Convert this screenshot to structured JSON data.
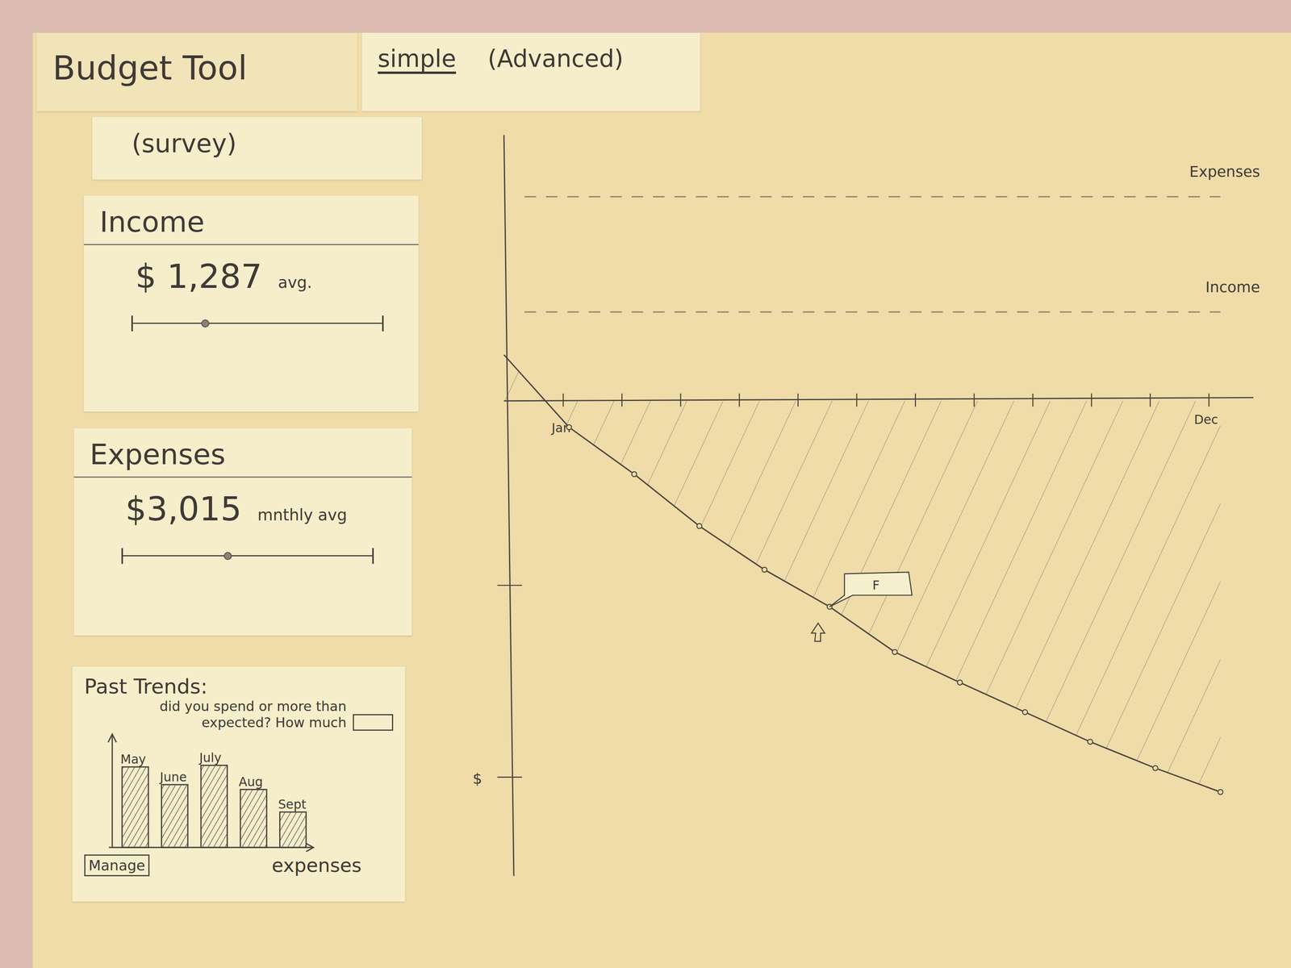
{
  "title": "Budget Tool",
  "tabs": [
    {
      "label": "simple",
      "selected": true
    },
    {
      "label": "(Advanced)",
      "selected": false
    }
  ],
  "survey": "(survey)",
  "income": {
    "title": "Income",
    "amount": "$ 1,287",
    "unit": "avg.",
    "level": 0.29
  },
  "expenses": {
    "title": "Expenses",
    "amount": "$3,015",
    "unit": "mnthly avg",
    "level": 0.42
  },
  "trends": {
    "title": "Past Trends:",
    "question": "did you spend or more than expected? How much",
    "input": "",
    "months": [
      "May",
      "June",
      "July",
      "Aug",
      "Sept"
    ],
    "values": [
      100,
      78,
      102,
      72,
      44
    ],
    "axis_label": "expenses",
    "button": "Manage"
  },
  "chart": {
    "x_labels": [
      "Jan",
      "Dec"
    ],
    "y_label": "$",
    "ticks": 12,
    "y_ticks": [
      -224,
      -457
    ],
    "balance": [
      56,
      -32,
      -89,
      -152,
      -205,
      -250,
      -305,
      -342,
      -378,
      -414,
      -446,
      -475
    ],
    "reference_lines": [
      {
        "label": "Expenses",
        "value": 248
      },
      {
        "label": "Income",
        "value": 108
      }
    ],
    "marker": {
      "label": "F",
      "index": 5
    }
  }
}
